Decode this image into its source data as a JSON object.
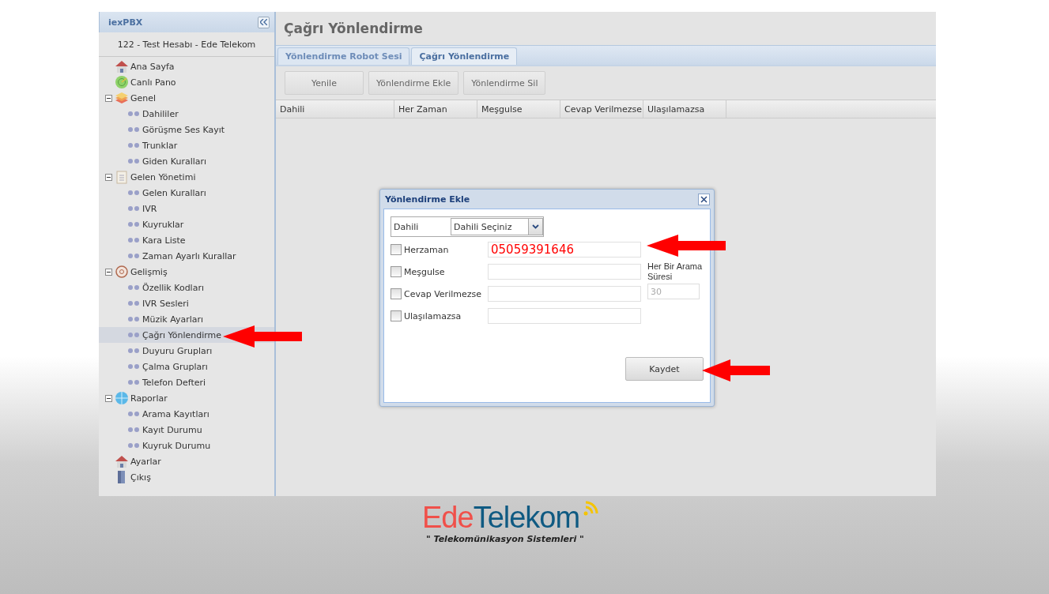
{
  "sidebar": {
    "title": "iexPBX",
    "account": "122 - Test Hesabı - Ede Telekom",
    "items": [
      {
        "label": "Ana Sayfa",
        "kind": "home",
        "selected": false
      },
      {
        "label": "Canlı Pano",
        "kind": "radar",
        "selected": false
      },
      {
        "label": "Genel",
        "kind": "layers",
        "selected": false,
        "expanded": true,
        "children": [
          {
            "label": "Dahililer",
            "selected": false
          },
          {
            "label": "Görüşme Ses Kayıt",
            "selected": false
          },
          {
            "label": "Trunklar",
            "selected": false
          },
          {
            "label": "Giden Kuralları",
            "selected": false
          }
        ]
      },
      {
        "label": "Gelen Yönetimi",
        "kind": "clipboard",
        "selected": false,
        "expanded": true,
        "children": [
          {
            "label": "Gelen Kuralları",
            "selected": false
          },
          {
            "label": "IVR",
            "selected": false
          },
          {
            "label": "Kuyruklar",
            "selected": false
          },
          {
            "label": "Kara Liste",
            "selected": false
          },
          {
            "label": "Zaman Ayarlı Kurallar",
            "selected": false
          }
        ]
      },
      {
        "label": "Gelişmiş",
        "kind": "gear",
        "selected": false,
        "expanded": true,
        "children": [
          {
            "label": "Özellik Kodları",
            "selected": false
          },
          {
            "label": "IVR Sesleri",
            "selected": false
          },
          {
            "label": "Müzik Ayarları",
            "selected": false
          },
          {
            "label": "Çağrı Yönlendirme",
            "selected": true
          },
          {
            "label": "Duyuru Grupları",
            "selected": false
          },
          {
            "label": "Çalma Grupları",
            "selected": false
          },
          {
            "label": "Telefon Defteri",
            "selected": false
          }
        ]
      },
      {
        "label": "Raporlar",
        "kind": "globe",
        "selected": false,
        "expanded": true,
        "children": [
          {
            "label": "Arama Kayıtları",
            "selected": false
          },
          {
            "label": "Kayıt Durumu",
            "selected": false
          },
          {
            "label": "Kuyruk Durumu",
            "selected": false
          }
        ]
      },
      {
        "label": "Ayarlar",
        "kind": "home",
        "selected": false
      },
      {
        "label": "Çıkış",
        "kind": "door",
        "selected": false
      }
    ]
  },
  "page_title": "Çağrı Yönlendirme",
  "tabs": [
    {
      "label": "Yönlendirme Robot Sesi",
      "selected": false
    },
    {
      "label": "Çağrı Yönlendirme",
      "selected": true
    }
  ],
  "toolbar": [
    "Yenile",
    "Yönlendirme Ekle",
    "Yönlendirme Sil"
  ],
  "table": {
    "columns": [
      "Dahili",
      "Her Zaman",
      "Meşgulse",
      "Cevap Verilmezse",
      "Ulaşılamazsa"
    ]
  },
  "dialog": {
    "title": "Yönlendirme Ekle",
    "rows": [
      {
        "kind": "select",
        "label": "Dahili",
        "value": "Dahili Seçiniz"
      },
      {
        "kind": "checkbox",
        "label": "Herzaman",
        "checked": false,
        "value": "05059391646"
      },
      {
        "kind": "checkbox",
        "label": "Meşgulse",
        "checked": false
      },
      {
        "kind": "checkbox",
        "label": "Cevap Verilmezse",
        "checked": false
      },
      {
        "kind": "checkbox",
        "label": "Ulaşılamazsa",
        "checked": false
      }
    ],
    "duration": {
      "label": "Her Bir Arama Süresi",
      "value": "30",
      "disabled": true
    },
    "button": "Kaydet"
  },
  "logo": {
    "parts": [
      {
        "text": "Ede",
        "color": "#f0504a"
      },
      {
        "text": "Telekom",
        "color": "#0f5a82"
      }
    ],
    "tagline": "\" Telekomünikasyon Sistemleri \""
  }
}
